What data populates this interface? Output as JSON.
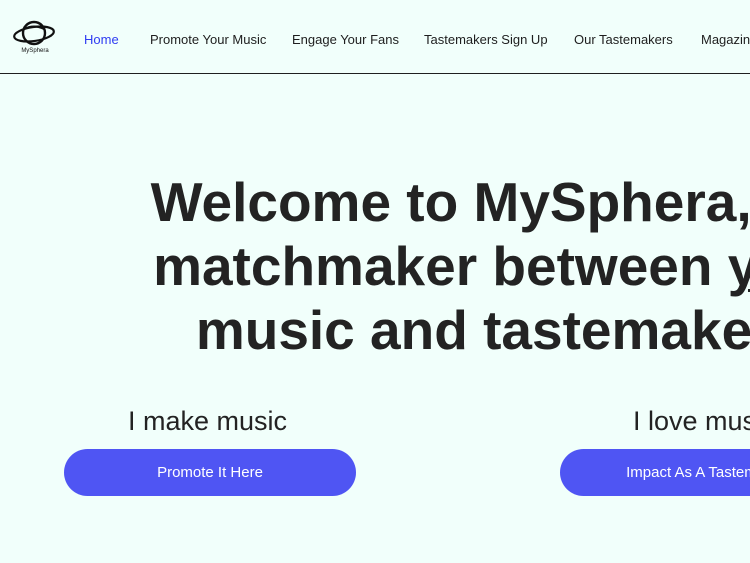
{
  "header": {
    "nav": [
      {
        "label": "Home",
        "active": true
      },
      {
        "label": "Promote Your Music",
        "active": false
      },
      {
        "label": "Engage Your Fans",
        "active": false
      },
      {
        "label": "Tastemakers Sign Up",
        "active": false
      },
      {
        "label": "Our Tastemakers",
        "active": false
      },
      {
        "label": "Magazine",
        "active": false
      }
    ],
    "logo_icon": "planet-logo-icon",
    "logo_text": "MySphera"
  },
  "hero": {
    "line1": "Welcome to MySphera, the",
    "line2_prefix": "matchmaker between ",
    "line2_underlined": "your",
    "line3": "music and tastemakers"
  },
  "sections": {
    "left": {
      "subtitle": "I make music",
      "button": "Promote It Here"
    },
    "right": {
      "subtitle": "I love music",
      "button": "Impact As A Tastemaker"
    }
  },
  "colors": {
    "background": "#f1fffb",
    "active_link": "#2f3cf2",
    "button": "#4f55f3",
    "text": "#232323"
  }
}
